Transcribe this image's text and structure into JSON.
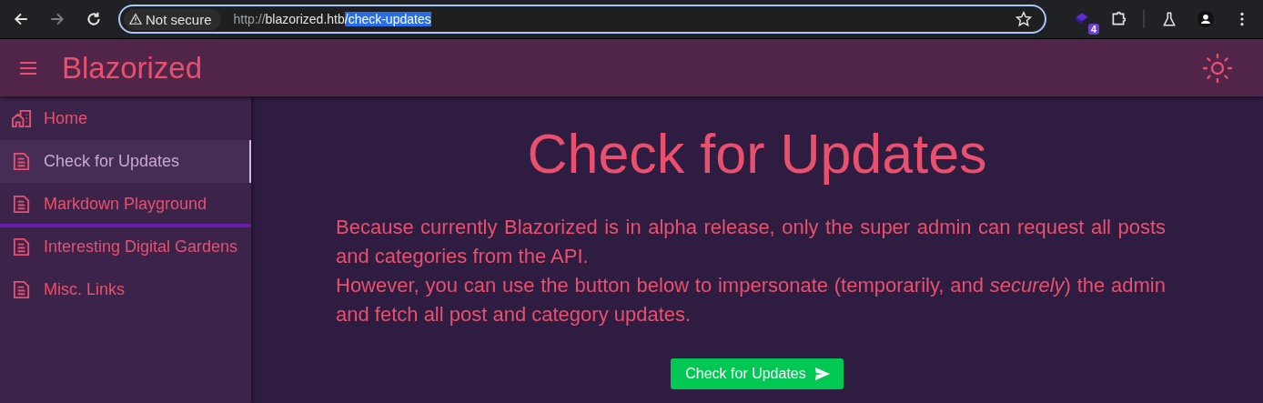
{
  "browser": {
    "security": "Not secure",
    "url": {
      "scheme": "http://",
      "host": "blazorized.htb",
      "selected_path": "/check-updates"
    },
    "extension_badge": "4"
  },
  "app_bar": {
    "title": "Blazorized"
  },
  "sidebar": {
    "items": [
      {
        "kind": "home",
        "label": "Home",
        "selected": false
      },
      {
        "kind": "page",
        "label": "Check for Updates",
        "selected": true
      },
      {
        "kind": "page",
        "label": "Markdown Playground",
        "selected": false
      },
      {
        "kind": "divider"
      },
      {
        "kind": "page",
        "label": "Interesting Digital Gardens",
        "selected": false
      },
      {
        "kind": "page",
        "label": "Misc. Links",
        "selected": false
      }
    ]
  },
  "main": {
    "heading": "Check for Updates",
    "paragraphs": [
      "Because currently Blazorized is in alpha release, only the super admin can request all posts and categories from the API.",
      "However, you can use the button below to impersonate (temporarily, and *securely*) the admin and fetch all post and category updates."
    ],
    "button": "Check for Updates"
  }
}
